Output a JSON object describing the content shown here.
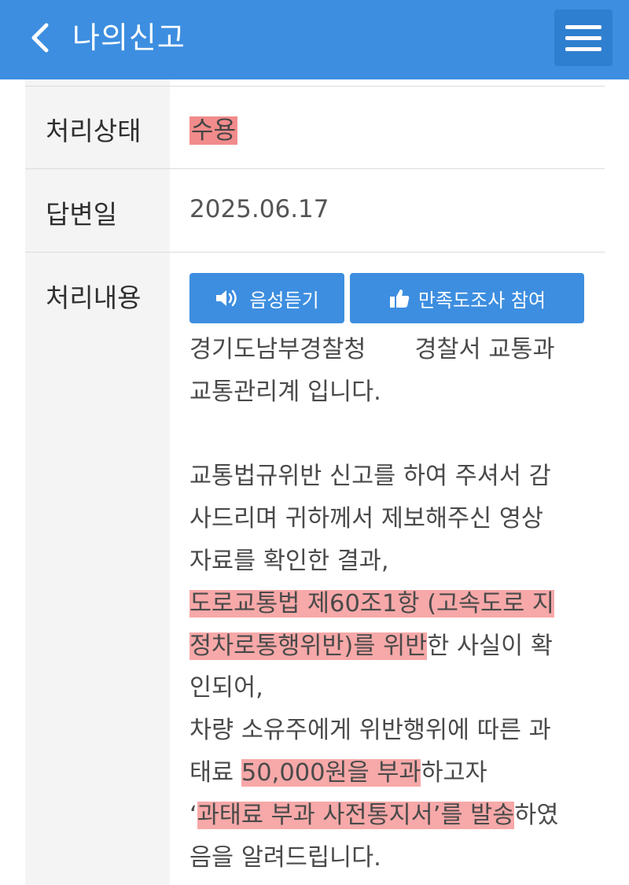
{
  "header": {
    "title": "나의신고"
  },
  "rows": {
    "status_label": "처리상태",
    "status_value": "수용",
    "date_label": "답변일",
    "date_value": "2025.06.17",
    "content_label": "처리내용"
  },
  "buttons": {
    "voice": "음성듣기",
    "survey": "만족도조사 참여"
  },
  "content": {
    "l1a": "경기도남부경찰청",
    "l1b": "경찰서 교통과",
    "l2": "교통관리계 입니다.",
    "l3": "교통법규위반 신고를 하여 주셔서 감",
    "l4": "사드리며 귀하께서 제보해주신 영상",
    "l5": "자료를 확인한 결과,",
    "l6": "도로교통법 제60조1항 (고속도로 지",
    "l7_hl": "정차로통행위반)를 위반",
    "l7_rest": "한 사실이 확",
    "l8": "인되어,",
    "l9": "차량 소유주에게 위반행위에 따른 과",
    "l10_pre": "태료 ",
    "l10_hl": "50,000원을 부과",
    "l10_post": "하고자",
    "l11_pre": "‘",
    "l11_hl": "과태료 부과 사전통지서’를 발송",
    "l11_post": "하였",
    "l12": "음을 알려드립니다."
  },
  "colors": {
    "header_bg": "#3d8ee0",
    "highlight": "#f7a8a8",
    "label_bg": "#f4f4f4"
  }
}
